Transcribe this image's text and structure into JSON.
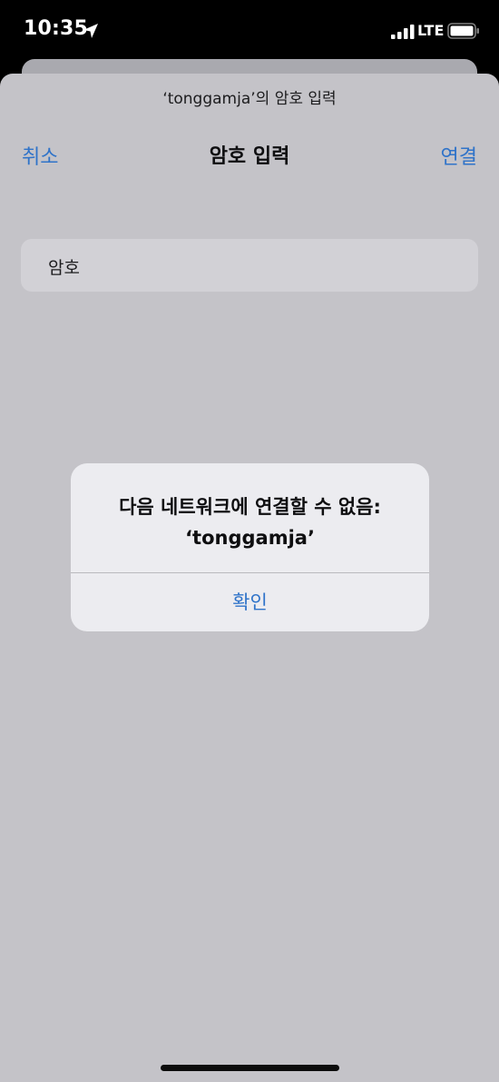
{
  "status_bar": {
    "time": "10:35",
    "network": "LTE",
    "icons": [
      "location-arrow-icon",
      "cellular-signal-icon",
      "battery-icon"
    ]
  },
  "sheet": {
    "prompt": "‘tonggamja’의 암호 입력",
    "nav": {
      "cancel_label": "취소",
      "title": "암호 입력",
      "join_label": "연결"
    },
    "password_field": {
      "label": "암호",
      "value": ""
    }
  },
  "alert": {
    "title_line1": "다음 네트워크에 연결할 수 없음:",
    "title_line2": "‘tonggamja’",
    "ok_label": "확인"
  },
  "colors": {
    "accent": "#2f73c9",
    "sheet_background": "#c4c3c8",
    "alert_background": "#ececf0"
  }
}
